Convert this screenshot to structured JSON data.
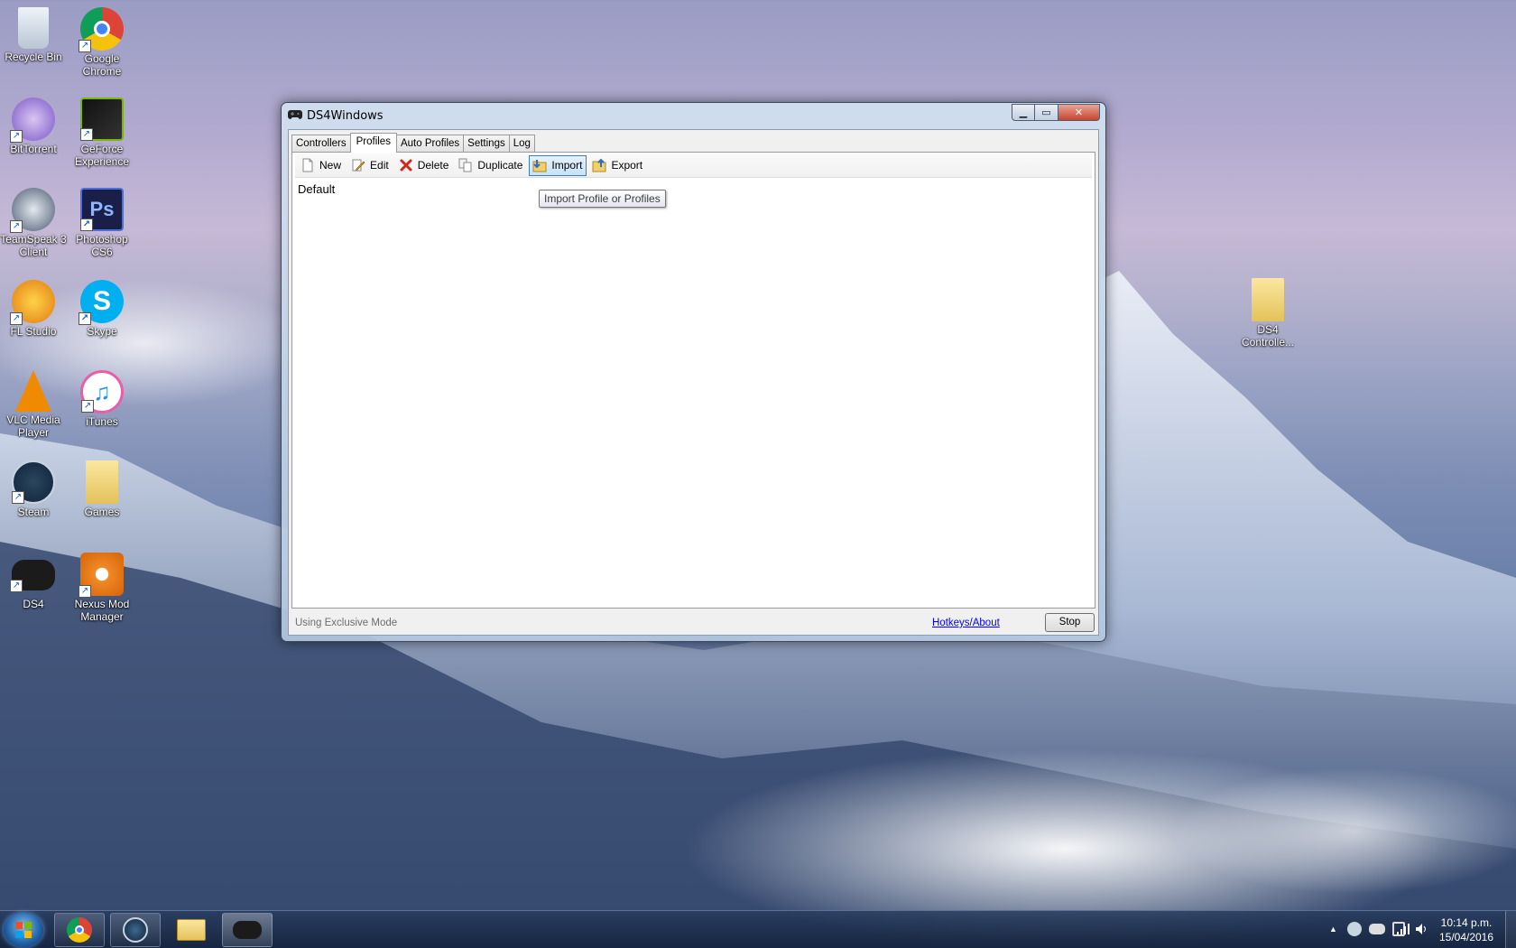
{
  "desktop": {
    "icons": [
      {
        "label": "Recycle Bin",
        "icon": "recycle-bin-icon"
      },
      {
        "label": "Google Chrome",
        "icon": "chrome-icon"
      },
      {
        "label": "BitTorrent",
        "icon": "bittorrent-icon"
      },
      {
        "label": "GeForce Experience",
        "icon": "geforce-icon"
      },
      {
        "label": "TeamSpeak 3 Client",
        "icon": "teamspeak-icon"
      },
      {
        "label": "Photoshop CS6",
        "icon": "photoshop-icon"
      },
      {
        "label": "FL Studio",
        "icon": "fl-studio-icon"
      },
      {
        "label": "Skype",
        "icon": "skype-icon"
      },
      {
        "label": "VLC Media Player",
        "icon": "vlc-icon"
      },
      {
        "label": "iTunes",
        "icon": "itunes-icon"
      },
      {
        "label": "Steam",
        "icon": "steam-icon"
      },
      {
        "label": "Games",
        "icon": "folder-icon"
      },
      {
        "label": "DS4",
        "icon": "gamepad-icon"
      },
      {
        "label": "Nexus Mod Manager",
        "icon": "nexus-icon"
      },
      {
        "label": "DS4 Controlle...",
        "icon": "folder-icon"
      }
    ]
  },
  "window": {
    "title": "DS4Windows",
    "tabs": [
      {
        "label": "Controllers"
      },
      {
        "label": "Profiles"
      },
      {
        "label": "Auto Profiles"
      },
      {
        "label": "Settings"
      },
      {
        "label": "Log"
      }
    ],
    "active_tab": "Profiles",
    "toolbar": {
      "new_label": "New",
      "edit_label": "Edit",
      "delete_label": "Delete",
      "duplicate_label": "Duplicate",
      "import_label": "Import",
      "export_label": "Export"
    },
    "profiles": [
      "Default"
    ],
    "tooltip": "Import Profile or Profiles",
    "status_text": "Using Exclusive Mode",
    "hotkeys_link": "Hotkeys/About",
    "stop_label": "Stop"
  },
  "taskbar": {
    "time": "10:14 p.m.",
    "date": "15/04/2016",
    "pinned": [
      "chrome-icon",
      "steam-icon",
      "file-explorer-icon",
      "gamepad-icon"
    ],
    "tray_up_arrow": "▲"
  }
}
